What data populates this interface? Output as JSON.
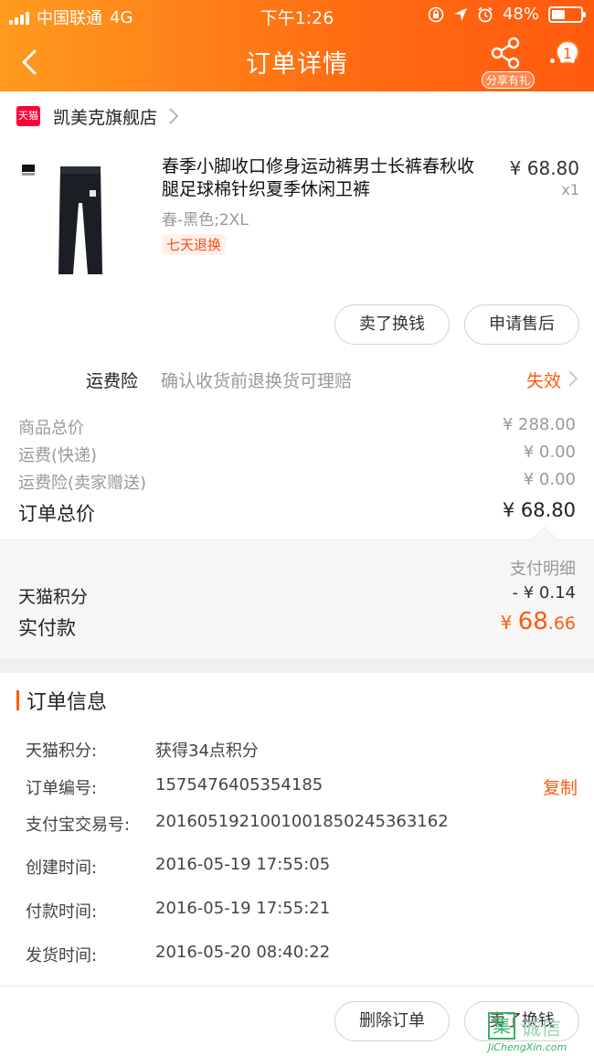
{
  "status_bar": {
    "carrier": "中国联通",
    "network": "4G",
    "time": "下午1:26",
    "battery": "48%",
    "battery_level": 0.48
  },
  "nav": {
    "title": "订单详情",
    "share_label": "分享有礼",
    "message_count": "1"
  },
  "store": {
    "logo_text": "天猫",
    "name": "凯美克旗舰店"
  },
  "product": {
    "title": "春季小脚收口修身运动裤男士长裤春秋收腿足球棉针织夏季休闲卫裤",
    "sku": "春-黑色;2XL",
    "tag": "七天退换",
    "price": "¥ 68.80",
    "qty": "x1",
    "buttons": [
      "卖了换钱",
      "申请售后"
    ]
  },
  "insurance": {
    "label": "运费险",
    "desc": "确认收货前退换货可理赔",
    "status": "失效"
  },
  "summary": {
    "rows": [
      {
        "k": "商品总价",
        "v": "¥ 288.00"
      },
      {
        "k": "运费(快递)",
        "v": "¥ 0.00"
      },
      {
        "k": "运费险(卖家赠送)",
        "v": "¥ 0.00"
      }
    ],
    "total_label": "订单总价",
    "total_value": "¥ 68.80"
  },
  "payment": {
    "detail_link": "支付明细",
    "points_label": "天猫积分",
    "points_value": "- ¥ 0.14",
    "paid_label": "实付款",
    "paid_currency": "¥ ",
    "paid_int": "68",
    "paid_dec": ".66"
  },
  "order_info": {
    "title": "订单信息",
    "rows": [
      {
        "k": "天猫积分:",
        "v": "获得34点积分"
      },
      {
        "k": "订单编号:",
        "v": "1575476405354185"
      },
      {
        "k": "支付宝交易号:",
        "v": "2016051921001001850245363162"
      },
      {
        "k": "创建时间:",
        "v": "2016-05-19 17:55:05"
      },
      {
        "k": "付款时间:",
        "v": "2016-05-19 17:55:21"
      },
      {
        "k": "发货时间:",
        "v": "2016-05-20 08:40:22"
      }
    ],
    "copy_label": "复制"
  },
  "bottom_buttons": [
    "删除订单",
    "卖了换钱"
  ],
  "watermark": {
    "char": "集",
    "text": "诚信",
    "url": "JiChengXin.com"
  },
  "colors": {
    "accent": "#ff5a0e",
    "header_start": "#ff9a1f",
    "header_end": "#ff5a0e",
    "tmall_red": "#ff0036"
  },
  "icons": [
    "back-icon",
    "share-icon",
    "more-icon",
    "tmall-logo",
    "chevron-right-icon",
    "wifi-icon",
    "location-icon",
    "alarm-icon",
    "lock-rotation-icon"
  ]
}
